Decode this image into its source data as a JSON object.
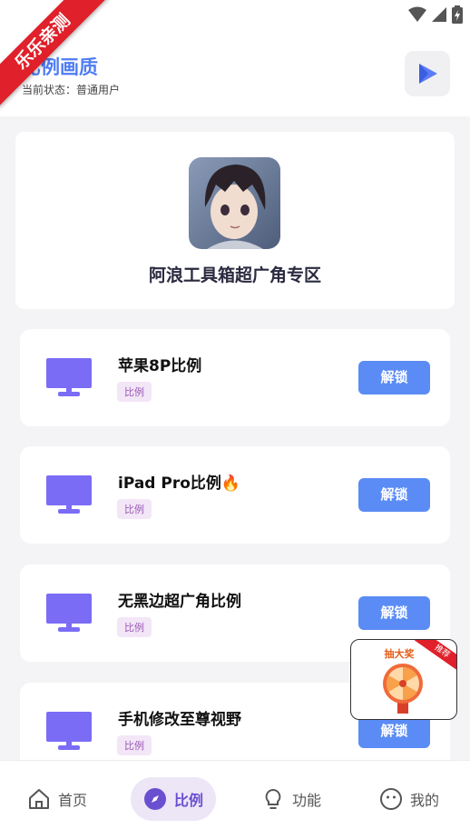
{
  "status_bar": {
    "icons": [
      "wifi-icon",
      "signal-icon",
      "battery-icon"
    ]
  },
  "ribbon": {
    "label": "乐乐亲测"
  },
  "header": {
    "title": "比例画质",
    "status": "当前状态：普通用户"
  },
  "profile": {
    "zone_title": "阿浪工具箱超广角专区"
  },
  "items": [
    {
      "title": "苹果8P比例",
      "tag": "比例",
      "button": "解锁"
    },
    {
      "title": "iPad Pro比例🔥",
      "tag": "比例",
      "button": "解锁"
    },
    {
      "title": "无黑边超广角比例",
      "tag": "比例",
      "button": "解锁"
    },
    {
      "title": "手机修改至尊视野",
      "tag": "比例",
      "button": "解锁"
    }
  ],
  "popup": {
    "title": "抽大奖",
    "corner": "推荐"
  },
  "nav": [
    {
      "label": "首页",
      "icon": "home-icon"
    },
    {
      "label": "比例",
      "icon": "compass-icon",
      "active": true
    },
    {
      "label": "功能",
      "icon": "lightbulb-icon"
    },
    {
      "label": "我的",
      "icon": "profile-icon"
    }
  ],
  "colors": {
    "accent": "#4f7cf5",
    "button": "#5b8cf5",
    "monitor": "#7b6cf6",
    "tag": "#9b59b6",
    "ribbon": "#e0202a"
  }
}
